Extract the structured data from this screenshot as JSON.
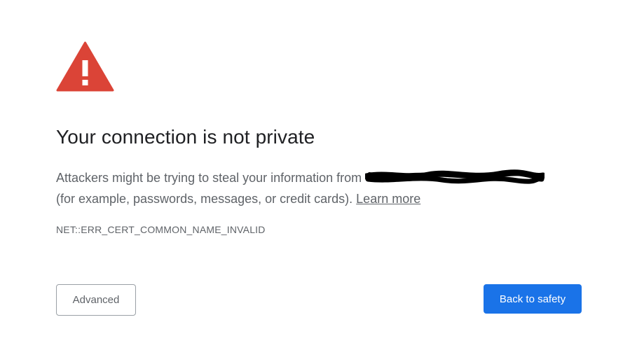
{
  "icons": {
    "warning": "warning-triangle-icon",
    "warning_color": "#db4437"
  },
  "heading": "Your connection is not private",
  "message": {
    "line1": "Attackers might be trying to steal your information from",
    "line2": "(for example, passwords, messages, or credit cards).",
    "learn_more": "Learn more"
  },
  "error_code": "NET::ERR_CERT_COMMON_NAME_INVALID",
  "buttons": {
    "advanced": "Advanced",
    "back_to_safety": "Back to safety"
  },
  "colors": {
    "primary": "#1a73e8",
    "text": "#202124",
    "secondary_text": "#5f6368"
  }
}
